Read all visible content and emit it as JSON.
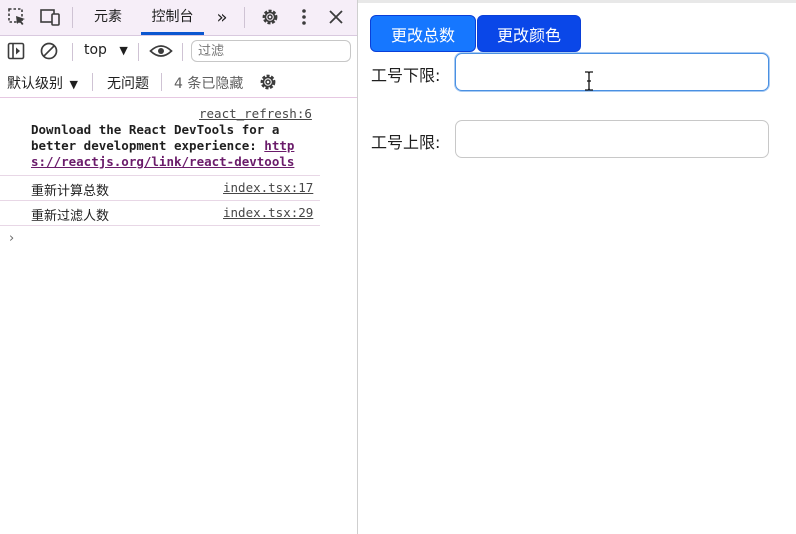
{
  "devtools": {
    "tabs": [
      {
        "label": "元素"
      },
      {
        "label": "控制台"
      }
    ],
    "more_tabs_label": "»",
    "context": "top",
    "filter_placeholder": "过滤",
    "levels_label": "默认级别",
    "issues_label": "无问题",
    "hidden_label": "4 条已隐藏",
    "console": {
      "entries": [
        {
          "source": "react_refresh:6",
          "line1": "Download the React DevTools for a",
          "line2": "better development experience: ",
          "link_part1": "http",
          "link_part2": "s://reactjs.org/link/react-devtools"
        },
        {
          "text": "重新计算总数",
          "source": "index.tsx:17"
        },
        {
          "text": "重新过滤人数",
          "source": "index.tsx:29"
        }
      ],
      "prompt": "›"
    }
  },
  "page": {
    "buttons": [
      {
        "label": "更改总数",
        "color": "#1677ff"
      },
      {
        "label": "更改颜色",
        "color": "#0a47e8"
      }
    ],
    "fields": [
      {
        "label": "工号下限:",
        "value": ""
      },
      {
        "label": "工号上限:",
        "value": ""
      }
    ]
  }
}
